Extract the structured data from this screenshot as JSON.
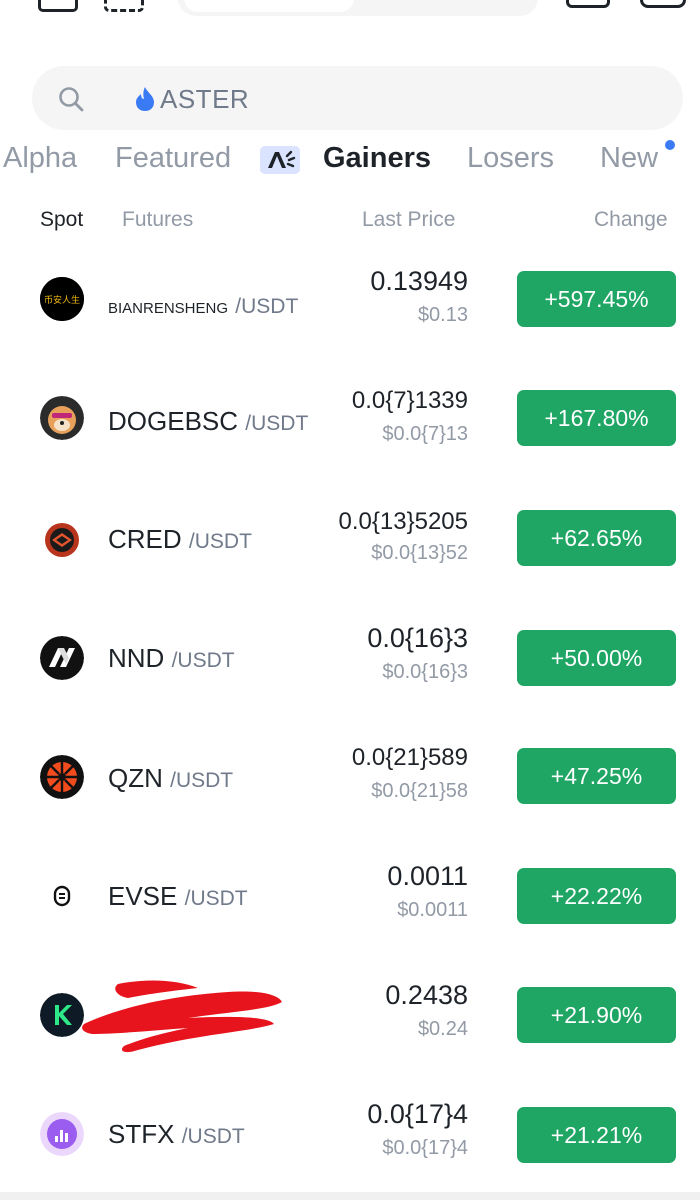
{
  "search": {
    "placeholder": "ASTER",
    "icon": "search-icon",
    "flame_color": "#3a7bf5"
  },
  "tabs": [
    {
      "label": "Alpha",
      "active": false
    },
    {
      "label": "Featured",
      "active": false
    },
    {
      "label": "Gainers",
      "active": true
    },
    {
      "label": "Losers",
      "active": false
    },
    {
      "label": "New",
      "active": false
    }
  ],
  "header": {
    "spot": "Spot",
    "futures": "Futures",
    "last_price": "Last Price",
    "change": "Change"
  },
  "colors": {
    "gain": "#1fa664",
    "text": "#1e2329",
    "muted": "#929aa5",
    "accent": "#3a7bf5"
  },
  "rows": [
    {
      "base": "BIANRENSHENG",
      "quote": "/USDT",
      "price": "0.13949",
      "usd": "$0.13",
      "change": "+597.45%",
      "logo_text": "币安人生"
    },
    {
      "base": "DOGEBSC",
      "quote": "/USDT",
      "price": "0.0{7}1339",
      "usd": "$0.0{7}13",
      "change": "+167.80%"
    },
    {
      "base": "CRED",
      "quote": "/USDT",
      "price": "0.0{13}5205",
      "usd": "$0.0{13}52",
      "change": "+62.65%"
    },
    {
      "base": "NND",
      "quote": "/USDT",
      "price": "0.0{16}3",
      "usd": "$0.0{16}3",
      "change": "+50.00%"
    },
    {
      "base": "QZN",
      "quote": "/USDT",
      "price": "0.0{21}589",
      "usd": "$0.0{21}58",
      "change": "+47.25%"
    },
    {
      "base": "EVSE",
      "quote": "/USDT",
      "price": "0.0011",
      "usd": "$0.0011",
      "change": "+22.22%"
    },
    {
      "base": "",
      "quote": "",
      "price": "0.2438",
      "usd": "$0.24",
      "change": "+21.90%"
    },
    {
      "base": "STFX",
      "quote": "/USDT",
      "price": "0.0{17}4",
      "usd": "$0.0{17}4",
      "change": "+21.21%"
    }
  ]
}
